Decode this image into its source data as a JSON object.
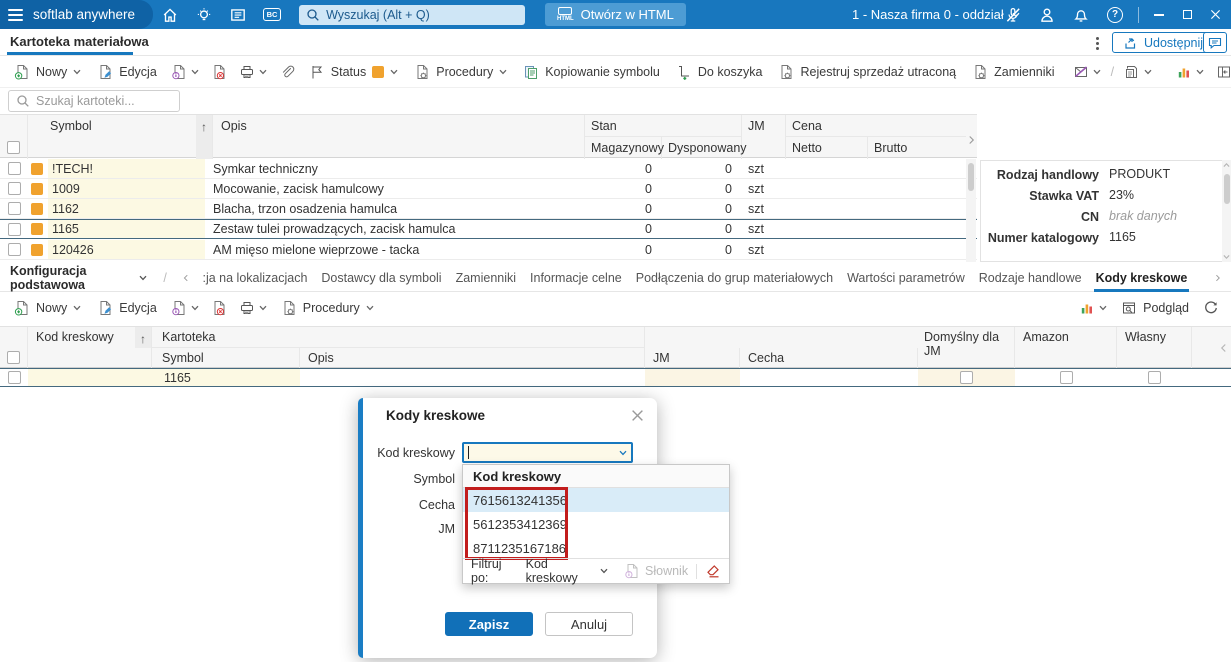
{
  "glyphs": {
    "bc": "BC",
    "html": "HTML",
    "question": "?",
    "sort_asc": "↑",
    "slash": "/"
  },
  "topbar": {
    "brand": "softlab anywhere",
    "search_placeholder": "Wyszukaj (Alt + Q)",
    "open_html": "Otwórz w HTML",
    "company_selector": "1 - Nasza firma 0 - oddział"
  },
  "tabrow": {
    "title": "Kartoteka materiałowa",
    "share": "Udostępnij"
  },
  "toolbar": {
    "nowy": "Nowy",
    "edycja": "Edycja",
    "status": "Status",
    "procedury": "Procedury",
    "kopiowanie": "Kopiowanie symbolu",
    "koszyk": "Do koszyka",
    "rejestruj": "Rejestruj sprzedaż utraconą",
    "zamienniki": "Zamienniki"
  },
  "search": {
    "placeholder": "Szukaj kartoteki..."
  },
  "grid": {
    "col_symbol": "Symbol",
    "col_opis": "Opis",
    "col_stan": "Stan",
    "col_magazynowy": "Magazynowy",
    "col_dysponowany": "Dysponowany",
    "col_jm": "JM",
    "col_cena": "Cena",
    "col_netto": "Netto",
    "col_brutto": "Brutto",
    "rows": [
      {
        "symbol": "!TECH!",
        "opis": "Symkar techniczny",
        "magazynowy": "0",
        "dysponowany": "0",
        "jm": "szt"
      },
      {
        "symbol": "1009",
        "opis": "Mocowanie, zacisk hamulcowy",
        "magazynowy": "0",
        "dysponowany": "0",
        "jm": "szt"
      },
      {
        "symbol": "1162",
        "opis": "Blacha, trzon osadzenia hamulca",
        "magazynowy": "0",
        "dysponowany": "0",
        "jm": "szt"
      },
      {
        "symbol": "1165",
        "opis": "Zestaw tulei prowadzących, zacisk hamulca",
        "magazynowy": "0",
        "dysponowany": "0",
        "jm": "szt"
      },
      {
        "symbol": "120426",
        "opis": "AM mięso mielone wieprzowe - tacka",
        "magazynowy": "0",
        "dysponowany": "0",
        "jm": "szt"
      }
    ]
  },
  "details": {
    "rows": [
      {
        "label": "Rodzaj handlowy",
        "value": "PRODUKT"
      },
      {
        "label": "Stawka VAT",
        "value": "23%"
      },
      {
        "label": "CN",
        "value": "brak danych"
      },
      {
        "label": "Numer katalogowy",
        "value": "1165"
      }
    ]
  },
  "subtabs": {
    "selector": "Konfiguracja podstawowa",
    "tabs": [
      ":ja na lokalizacjach",
      "Dostawcy dla symboli",
      "Zamienniki",
      "Informacje celne",
      "Podłączenia do grup materiałowych",
      "Wartości parametrów",
      "Rodzaje handlowe",
      "Kody kreskowe"
    ]
  },
  "subtoolbar": {
    "nowy": "Nowy",
    "edycja": "Edycja",
    "procedury": "Procedury",
    "podglad": "Podgląd"
  },
  "grid2": {
    "col_kod": "Kod kreskowy",
    "col_kartoteka": "Kartoteka",
    "col_symbol": "Symbol",
    "col_opis": "Opis",
    "col_jm": "JM",
    "col_cecha": "Cecha",
    "col_domyslny": "Domyślny dla JM",
    "col_amazon": "Amazon",
    "col_wlasny": "Własny",
    "row": {
      "symbol": "1165"
    }
  },
  "modal": {
    "title": "Kody kreskowe",
    "label_kod": "Kod kreskowy",
    "label_symbol": "Symbol",
    "label_cecha": "Cecha",
    "label_jm": "JM",
    "dd_header": "Kod kreskowy",
    "options": [
      "7615613241356",
      "5612353412369",
      "8711235167186"
    ],
    "filter_label": "Filtruj po:",
    "filter_value": "Kod kreskowy",
    "slownik": "Słownik",
    "save": "Zapisz",
    "cancel": "Anuluj"
  },
  "colors": {
    "accent": "#1778be",
    "status_orange": "#f0a22e",
    "highlight_red": "#c21d1d"
  }
}
